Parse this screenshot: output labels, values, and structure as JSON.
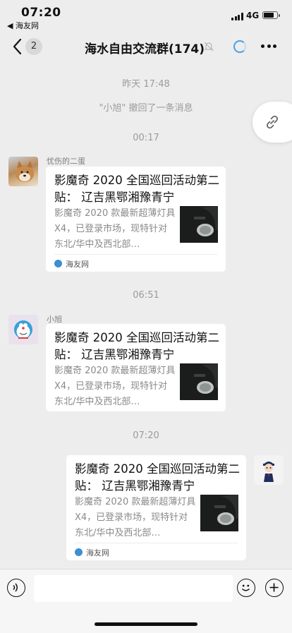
{
  "status_bar": {
    "time": "07:20",
    "back_app": "◀ 海友网",
    "network": "4G"
  },
  "nav": {
    "back_count": "2",
    "title": "海水自由交流群(174)"
  },
  "chat": {
    "timestamp_1": "昨天 17:48",
    "system_message": "\"小旭\" 撤回了一条消息",
    "timestamp_2": "00:17",
    "timestamp_3": "06:51",
    "timestamp_4": "07:20",
    "messages": [
      {
        "sender": "忧伤的二蛋",
        "title": "影魔奇 2020 全国巡回活动第二贴：  辽吉黑鄂湘豫青宁",
        "description": "影魔奇 2020 款最新超薄灯具 X4，已登录市场，现特针对东北/华中及西北部…",
        "source": "海友网"
      },
      {
        "sender": "小旭",
        "title": "影魔奇 2020 全国巡回活动第二贴：  辽吉黑鄂湘豫青宁",
        "description": "影魔奇 2020 款最新超薄灯具 X4，已登录市场，现特针对东北/华中及西北部…"
      },
      {
        "title": "影魔奇 2020 全国巡回活动第二贴：  辽吉黑鄂湘豫青宁",
        "description": "影魔奇 2020 款最新超薄灯具 X4，已登录市场，现特针对东北/华中及西北部…",
        "source": "海友网"
      }
    ]
  },
  "icons": {
    "back": "chevron-left-icon",
    "mute": "bell-muted-icon",
    "loading": "loading-spinner-icon",
    "more": "more-dots-icon",
    "link": "link-icon",
    "voice": "voice-icon",
    "emoji": "emoji-icon",
    "plus": "plus-icon"
  },
  "colors": {
    "background": "#ededed",
    "card": "#ffffff",
    "accent": "#4a9fe6"
  }
}
